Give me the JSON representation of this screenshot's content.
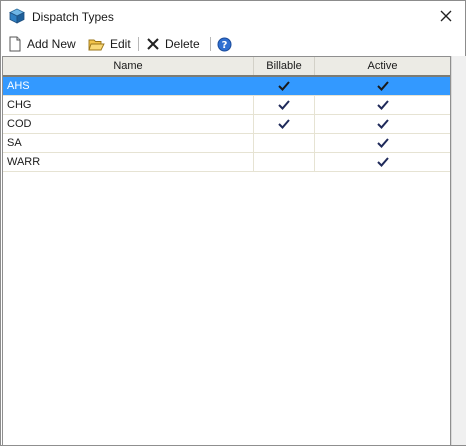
{
  "window": {
    "title": "Dispatch Types",
    "icon": "cube-icon",
    "close_icon": "close-icon"
  },
  "toolbar": {
    "add_label": "Add New",
    "edit_label": "Edit",
    "delete_label": "Delete",
    "help_icon": "help-icon"
  },
  "grid": {
    "columns": [
      "Name",
      "Billable",
      "Active"
    ],
    "rows": [
      {
        "name": "AHS",
        "billable": true,
        "active": true,
        "selected": true
      },
      {
        "name": "CHG",
        "billable": true,
        "active": true,
        "selected": false
      },
      {
        "name": "COD",
        "billable": true,
        "active": true,
        "selected": false
      },
      {
        "name": "SA",
        "billable": false,
        "active": true,
        "selected": false
      },
      {
        "name": "WARR",
        "billable": false,
        "active": true,
        "selected": false
      }
    ]
  },
  "colors": {
    "selection": "#3399ff",
    "header": "#ecebe5",
    "check": "#1f2a5a",
    "check_selected": "#1a1a1a"
  }
}
